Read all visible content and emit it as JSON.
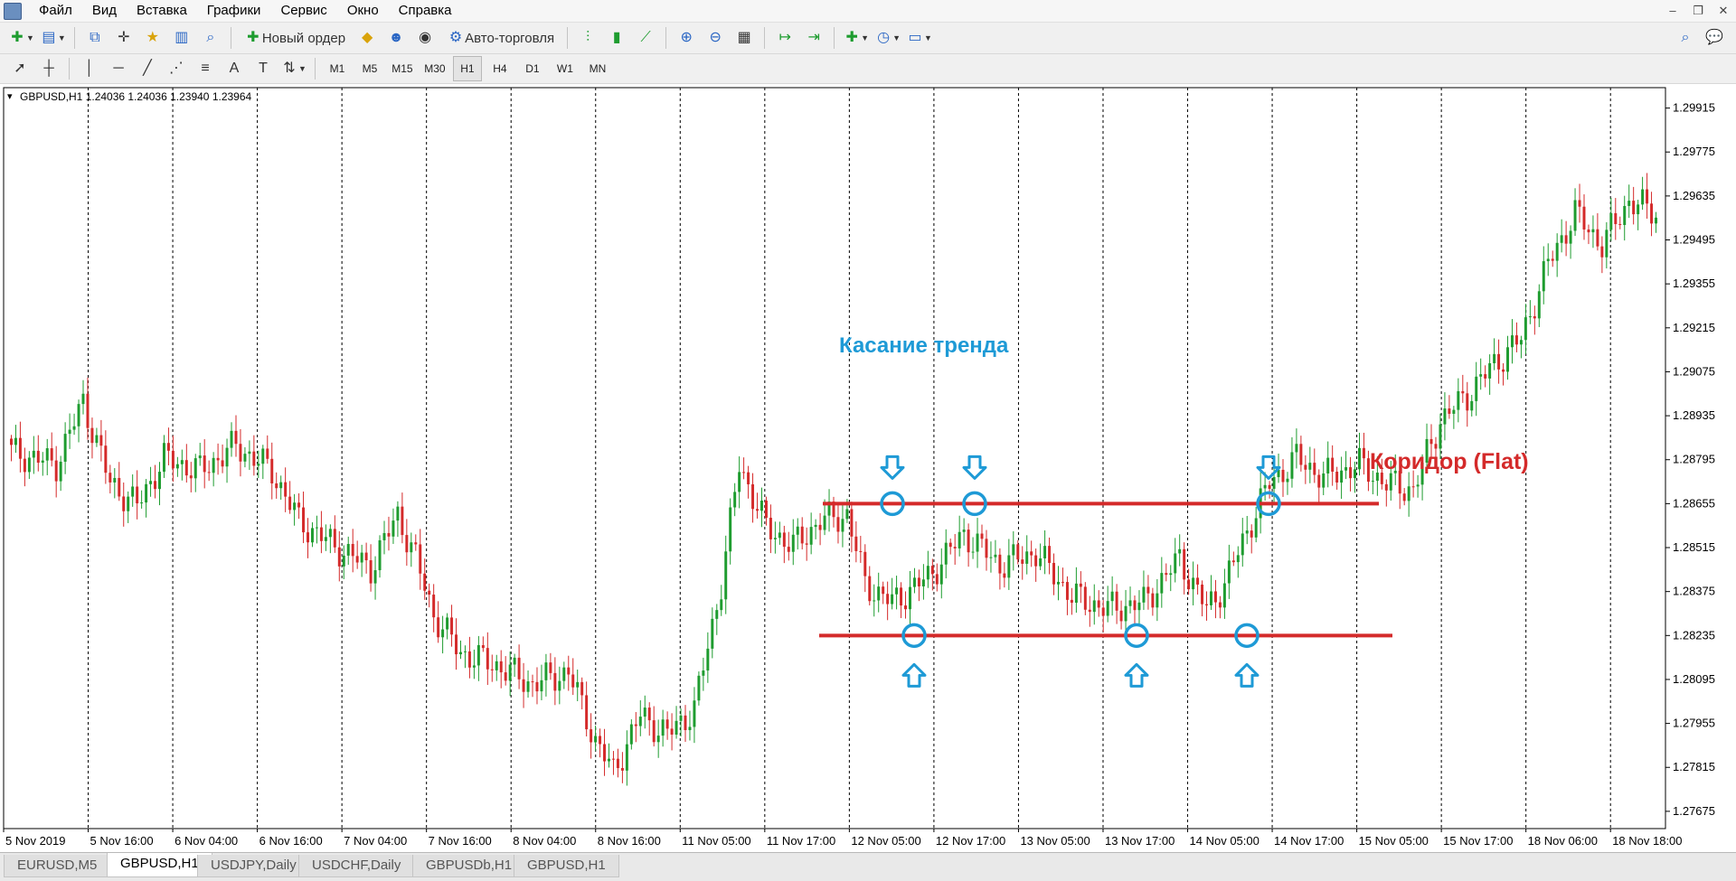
{
  "menu": [
    "Файл",
    "Вид",
    "Вставка",
    "Графики",
    "Сервис",
    "Окно",
    "Справка"
  ],
  "window_controls": [
    "minimize-icon",
    "restore-icon",
    "close-icon"
  ],
  "toolbar": {
    "new_order_label": "Новый ордер",
    "auto_trading_label": "Авто-торговля"
  },
  "timeframes": [
    "M1",
    "M5",
    "M15",
    "M30",
    "H1",
    "H4",
    "D1",
    "W1",
    "MN"
  ],
  "active_timeframe": "H1",
  "chart": {
    "header": "GBPUSD,H1  1.24036 1.24036 1.23940 1.23964",
    "annotation_touch": "Касание тренда",
    "annotation_corridor": "Коридор (Flat)",
    "colors": {
      "up": "#1e9c2f",
      "down": "#d42a2a",
      "touch": "#1e9ad6",
      "level": "#d42a2a",
      "grid": "#000000"
    }
  },
  "chart_data": {
    "type": "candlestick",
    "symbol": "GBPUSD",
    "timeframe": "H1",
    "y_ticks": [
      1.29915,
      1.29775,
      1.29635,
      1.29495,
      1.29355,
      1.29215,
      1.29075,
      1.28935,
      1.28795,
      1.28655,
      1.28515,
      1.28375,
      1.28235,
      1.28095,
      1.27955,
      1.27815,
      1.27675
    ],
    "y_range": [
      1.2762,
      1.2998
    ],
    "x_labels": [
      "5 Nov 2019",
      "5 Nov 16:00",
      "6 Nov 04:00",
      "6 Nov 16:00",
      "7 Nov 04:00",
      "7 Nov 16:00",
      "8 Nov 04:00",
      "8 Nov 16:00",
      "11 Nov 05:00",
      "11 Nov 17:00",
      "12 Nov 05:00",
      "12 Nov 17:00",
      "13 Nov 05:00",
      "13 Nov 17:00",
      "14 Nov 05:00",
      "14 Nov 17:00",
      "15 Nov 05:00",
      "15 Nov 17:00",
      "18 Nov 06:00",
      "18 Nov 18:00"
    ],
    "resistance": 1.28655,
    "support": 1.28235,
    "touches_top": 3,
    "touches_bottom": 3,
    "close_path": [
      [
        0,
        1.2882
      ],
      [
        10,
        1.2878
      ],
      [
        16,
        1.2898
      ],
      [
        22,
        1.2872
      ],
      [
        28,
        1.2865
      ],
      [
        34,
        1.288
      ],
      [
        42,
        1.2876
      ],
      [
        50,
        1.2884
      ],
      [
        58,
        1.2876
      ],
      [
        64,
        1.286
      ],
      [
        72,
        1.2852
      ],
      [
        80,
        1.2845
      ],
      [
        86,
        1.2862
      ],
      [
        90,
        1.2848
      ],
      [
        94,
        1.283
      ],
      [
        100,
        1.2818
      ],
      [
        108,
        1.2814
      ],
      [
        116,
        1.2808
      ],
      [
        124,
        1.2812
      ],
      [
        130,
        1.279
      ],
      [
        134,
        1.278
      ],
      [
        140,
        1.2798
      ],
      [
        146,
        1.2792
      ],
      [
        152,
        1.28
      ],
      [
        158,
        1.284
      ],
      [
        162,
        1.2878
      ],
      [
        168,
        1.2858
      ],
      [
        174,
        1.2852
      ],
      [
        180,
        1.286
      ],
      [
        186,
        1.2862
      ],
      [
        190,
        1.284
      ],
      [
        196,
        1.2834
      ],
      [
        204,
        1.2842
      ],
      [
        212,
        1.2856
      ],
      [
        220,
        1.2846
      ],
      [
        228,
        1.285
      ],
      [
        236,
        1.2836
      ],
      [
        244,
        1.2832
      ],
      [
        252,
        1.2834
      ],
      [
        260,
        1.2848
      ],
      [
        266,
        1.2832
      ],
      [
        270,
        1.284
      ],
      [
        276,
        1.286
      ],
      [
        280,
        1.2872
      ],
      [
        286,
        1.288
      ],
      [
        292,
        1.2874
      ],
      [
        300,
        1.2878
      ],
      [
        306,
        1.2872
      ],
      [
        312,
        1.287
      ],
      [
        318,
        1.2892
      ],
      [
        324,
        1.29
      ],
      [
        330,
        1.291
      ],
      [
        336,
        1.2918
      ],
      [
        342,
        1.2942
      ],
      [
        348,
        1.2958
      ],
      [
        354,
        1.2948
      ],
      [
        360,
        1.2962
      ],
      [
        366,
        1.2958
      ]
    ]
  },
  "tabs": [
    "EURUSD,M5",
    "GBPUSD,H1",
    "USDJPY,Daily",
    "USDCHF,Daily",
    "GBPUSDb,H1",
    "GBPUSD,H1"
  ],
  "active_tab": "GBPUSD,H1"
}
